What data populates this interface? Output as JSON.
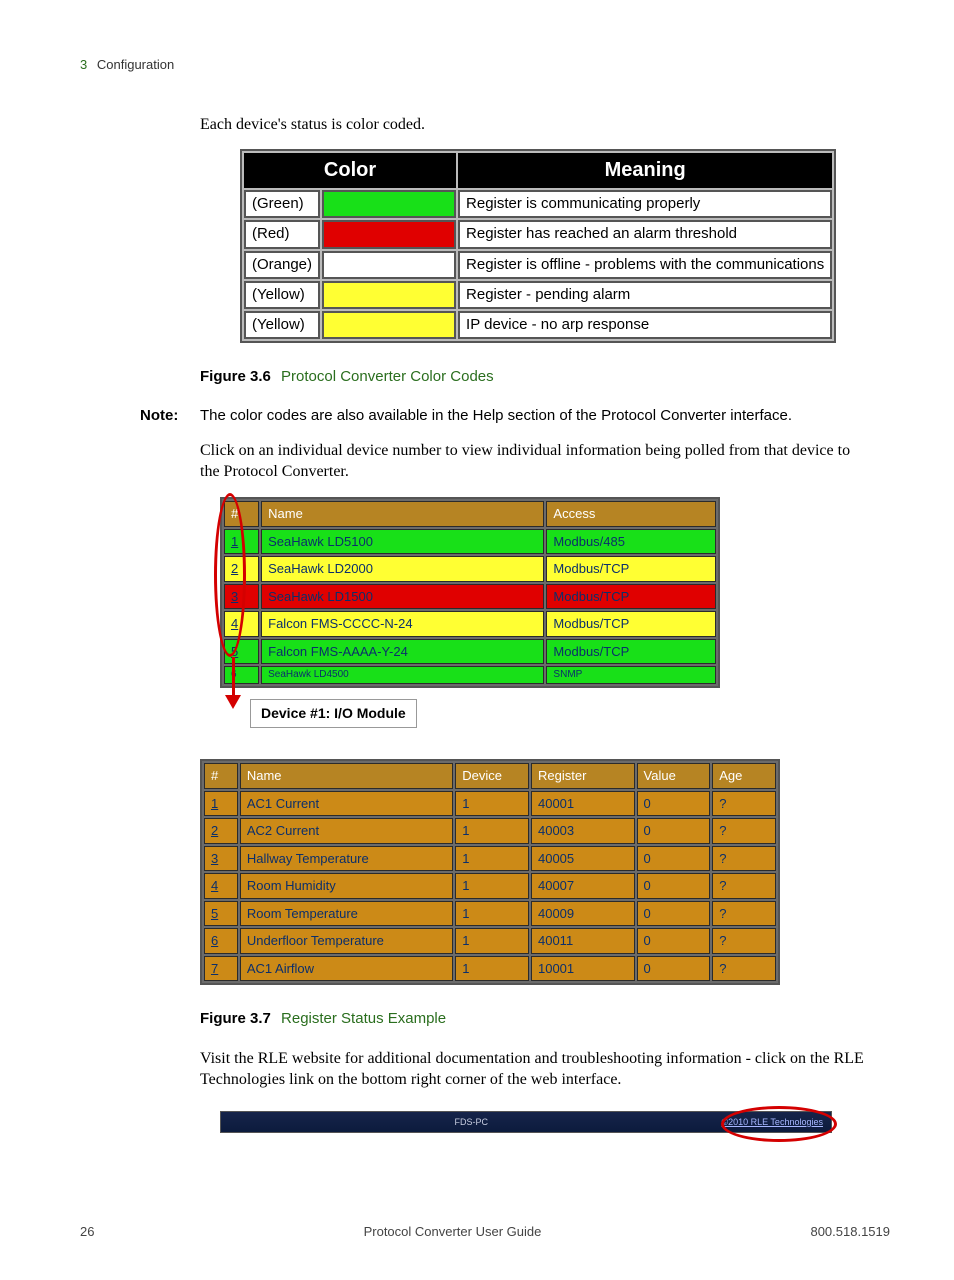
{
  "breadcrumb": {
    "chapter_num": "3",
    "chapter_title": "Configuration"
  },
  "intro_para": "Each device's status is color coded.",
  "color_table": {
    "header": {
      "color": "Color",
      "meaning": "Meaning"
    },
    "rows": [
      {
        "label": "(Green)",
        "swatch": "swatch-green",
        "meaning": "Register is communicating properly"
      },
      {
        "label": "(Red)",
        "swatch": "swatch-red",
        "meaning": "Register has reached an alarm threshold"
      },
      {
        "label": "(Orange)",
        "swatch": "",
        "meaning": "Register is offline - problems with the communications"
      },
      {
        "label": "(Yellow)",
        "swatch": "swatch-yellow",
        "meaning": "Register - pending alarm"
      },
      {
        "label": "(Yellow)",
        "swatch": "swatch-yellow",
        "meaning": "IP device - no arp response"
      }
    ]
  },
  "fig36": {
    "label": "Figure 3.6",
    "title": "Protocol Converter Color Codes"
  },
  "note": {
    "label": "Note:",
    "text": "The color codes are also available in the Help section of the Protocol Converter interface."
  },
  "para2": "Click on an individual device number to view individual information being polled from that device to the Protocol Converter.",
  "device_table": {
    "header": {
      "num": "#",
      "name": "Name",
      "access": "Access"
    },
    "rows": [
      {
        "idx": "1",
        "name": "SeaHawk LD5100",
        "access": "Modbus/485",
        "cls": "row-green"
      },
      {
        "idx": "2",
        "name": "SeaHawk LD2000",
        "access": "Modbus/TCP",
        "cls": "row-yellow"
      },
      {
        "idx": "3",
        "name": "SeaHawk LD1500",
        "access": "Modbus/TCP",
        "cls": "row-red"
      },
      {
        "idx": "4",
        "name": "Falcon FMS-CCCC-N-24",
        "access": "Modbus/TCP",
        "cls": "row-yellow"
      },
      {
        "idx": "5",
        "name": "Falcon FMS-AAAA-Y-24",
        "access": "Modbus/TCP",
        "cls": "row-green"
      }
    ],
    "partial_row": {
      "idx": "6",
      "name": "SeaHawk LD4500",
      "access": "SNMP"
    }
  },
  "device_label": "Device #1:   I/O Module",
  "register_table": {
    "header": {
      "num": "#",
      "name": "Name",
      "device": "Device",
      "register": "Register",
      "value": "Value",
      "age": "Age"
    },
    "rows": [
      {
        "idx": "1",
        "name": "AC1 Current",
        "device": "1",
        "register": "40001",
        "value": "0",
        "age": "?"
      },
      {
        "idx": "2",
        "name": "AC2 Current",
        "device": "1",
        "register": "40003",
        "value": "0",
        "age": "?"
      },
      {
        "idx": "3",
        "name": "Hallway Temperature",
        "device": "1",
        "register": "40005",
        "value": "0",
        "age": "?"
      },
      {
        "idx": "4",
        "name": "Room Humidity",
        "device": "1",
        "register": "40007",
        "value": "0",
        "age": "?"
      },
      {
        "idx": "5",
        "name": "Room Temperature",
        "device": "1",
        "register": "40009",
        "value": "0",
        "age": "?"
      },
      {
        "idx": "6",
        "name": "Underfloor Temperature",
        "device": "1",
        "register": "40011",
        "value": "0",
        "age": "?"
      },
      {
        "idx": "7",
        "name": "AC1 Airflow",
        "device": "1",
        "register": "10001",
        "value": "0",
        "age": "?"
      }
    ]
  },
  "fig37": {
    "label": "Figure 3.7",
    "title": "Register Status Example"
  },
  "para3": "Visit the RLE website for additional documentation and troubleshooting information - click on the RLE Technologies link on the bottom right corner of the web interface.",
  "footer_bar": {
    "center": "FDS-PC",
    "right": "©2010 RLE Technologies"
  },
  "page_footer": {
    "page_num": "26",
    "title": "Protocol Converter User Guide",
    "phone": "800.518.1519"
  }
}
